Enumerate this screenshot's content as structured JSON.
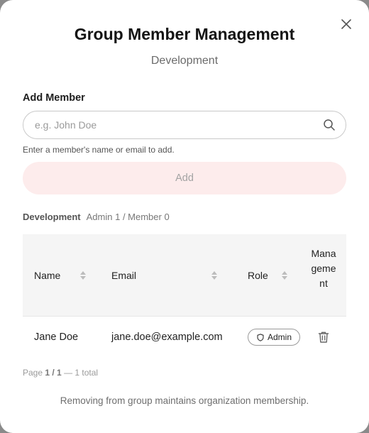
{
  "modal": {
    "title": "Group Member Management",
    "subtitle": "Development",
    "close_icon": "close-icon"
  },
  "add_member": {
    "label": "Add Member",
    "input_value": "",
    "placeholder": "e.g. John Doe",
    "search_icon": "search-icon",
    "hint": "Enter a member's name or email to add.",
    "add_button_label": "Add",
    "add_button_color": "#fdecec"
  },
  "group": {
    "name": "Development",
    "summary": "Admin 1 / Member 0"
  },
  "table": {
    "columns": [
      {
        "label": "Name",
        "sortable": true
      },
      {
        "label": "Email",
        "sortable": true
      },
      {
        "label": "Role",
        "sortable": true
      },
      {
        "label": "Management",
        "sortable": false
      }
    ],
    "rows": [
      {
        "name": "Jane Doe",
        "email": "jane.doe@example.com",
        "role": "Admin",
        "role_icon": "shield-icon",
        "action_icon": "trash-icon"
      }
    ]
  },
  "pagination": {
    "prefix": "Page",
    "current": "1 / 1",
    "total": "— 1 total"
  },
  "footer_note": "Removing from group maintains organization membership."
}
